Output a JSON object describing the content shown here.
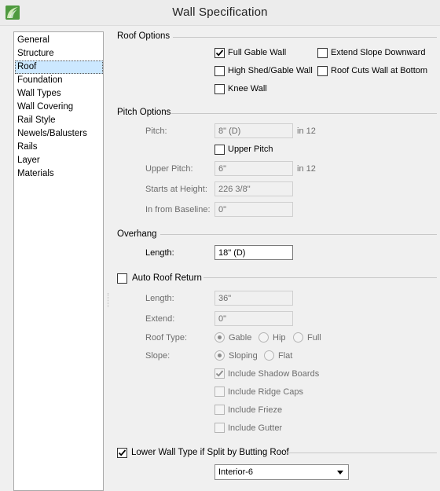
{
  "window": {
    "title": "Wall Specification"
  },
  "sidebar": {
    "items": [
      {
        "label": "General"
      },
      {
        "label": "Structure"
      },
      {
        "label": "Roof"
      },
      {
        "label": "Foundation"
      },
      {
        "label": "Wall Types"
      },
      {
        "label": "Wall Covering"
      },
      {
        "label": "Rail Style"
      },
      {
        "label": "Newels/Balusters"
      },
      {
        "label": "Rails"
      },
      {
        "label": "Layer"
      },
      {
        "label": "Materials"
      }
    ],
    "selected": "Roof"
  },
  "roof_options": {
    "heading": "Roof Options",
    "full_gable_wall": {
      "label": "Full Gable Wall",
      "checked": true
    },
    "high_shed_gable_wall": {
      "label": "High Shed/Gable Wall",
      "checked": false
    },
    "knee_wall": {
      "label": "Knee Wall",
      "checked": false
    },
    "extend_slope_downward": {
      "label": "Extend Slope Downward",
      "checked": false
    },
    "roof_cuts_wall_at_bottom": {
      "label": "Roof Cuts Wall at Bottom",
      "checked": false
    }
  },
  "pitch_options": {
    "heading": "Pitch Options",
    "pitch_label": "Pitch:",
    "pitch_value": "8\" (D)",
    "pitch_unit": "in 12",
    "upper_pitch_check": {
      "label": "Upper Pitch",
      "checked": false
    },
    "upper_pitch_label": "Upper Pitch:",
    "upper_pitch_value": "6\"",
    "upper_pitch_unit": "in 12",
    "starts_at_height_label": "Starts at Height:",
    "starts_at_height_value": "226 3/8\"",
    "in_from_baseline_label": "In from Baseline:",
    "in_from_baseline_value": "0\""
  },
  "overhang": {
    "heading": "Overhang",
    "length_label": "Length:",
    "length_value": "18\" (D)"
  },
  "auto_roof_return": {
    "label": "Auto Roof Return",
    "checked": false,
    "length_label": "Length:",
    "length_value": "36\"",
    "extend_label": "Extend:",
    "extend_value": "0\"",
    "roof_type_label": "Roof Type:",
    "roof_type_options": [
      "Gable",
      "Hip",
      "Full"
    ],
    "roof_type_selected": "Gable",
    "slope_label": "Slope:",
    "slope_options": [
      "Sloping",
      "Flat"
    ],
    "slope_selected": "Sloping",
    "include_shadow_boards": {
      "label": "Include Shadow Boards",
      "checked": true
    },
    "include_ridge_caps": {
      "label": "Include Ridge Caps",
      "checked": false
    },
    "include_frieze": {
      "label": "Include Frieze",
      "checked": false
    },
    "include_gutter": {
      "label": "Include Gutter",
      "checked": false
    }
  },
  "lower_wall": {
    "label": "Lower Wall Type if Split by Butting Roof",
    "checked": true,
    "select_value": "Interior-6"
  },
  "icons": {
    "app": "app-logo-icon",
    "check": "check-icon",
    "dropdown": "chevron-down-icon"
  },
  "colors": {
    "selection": "#cce8ff",
    "background": "#f0f0f0",
    "disabled_text": "#6d6d6d"
  }
}
